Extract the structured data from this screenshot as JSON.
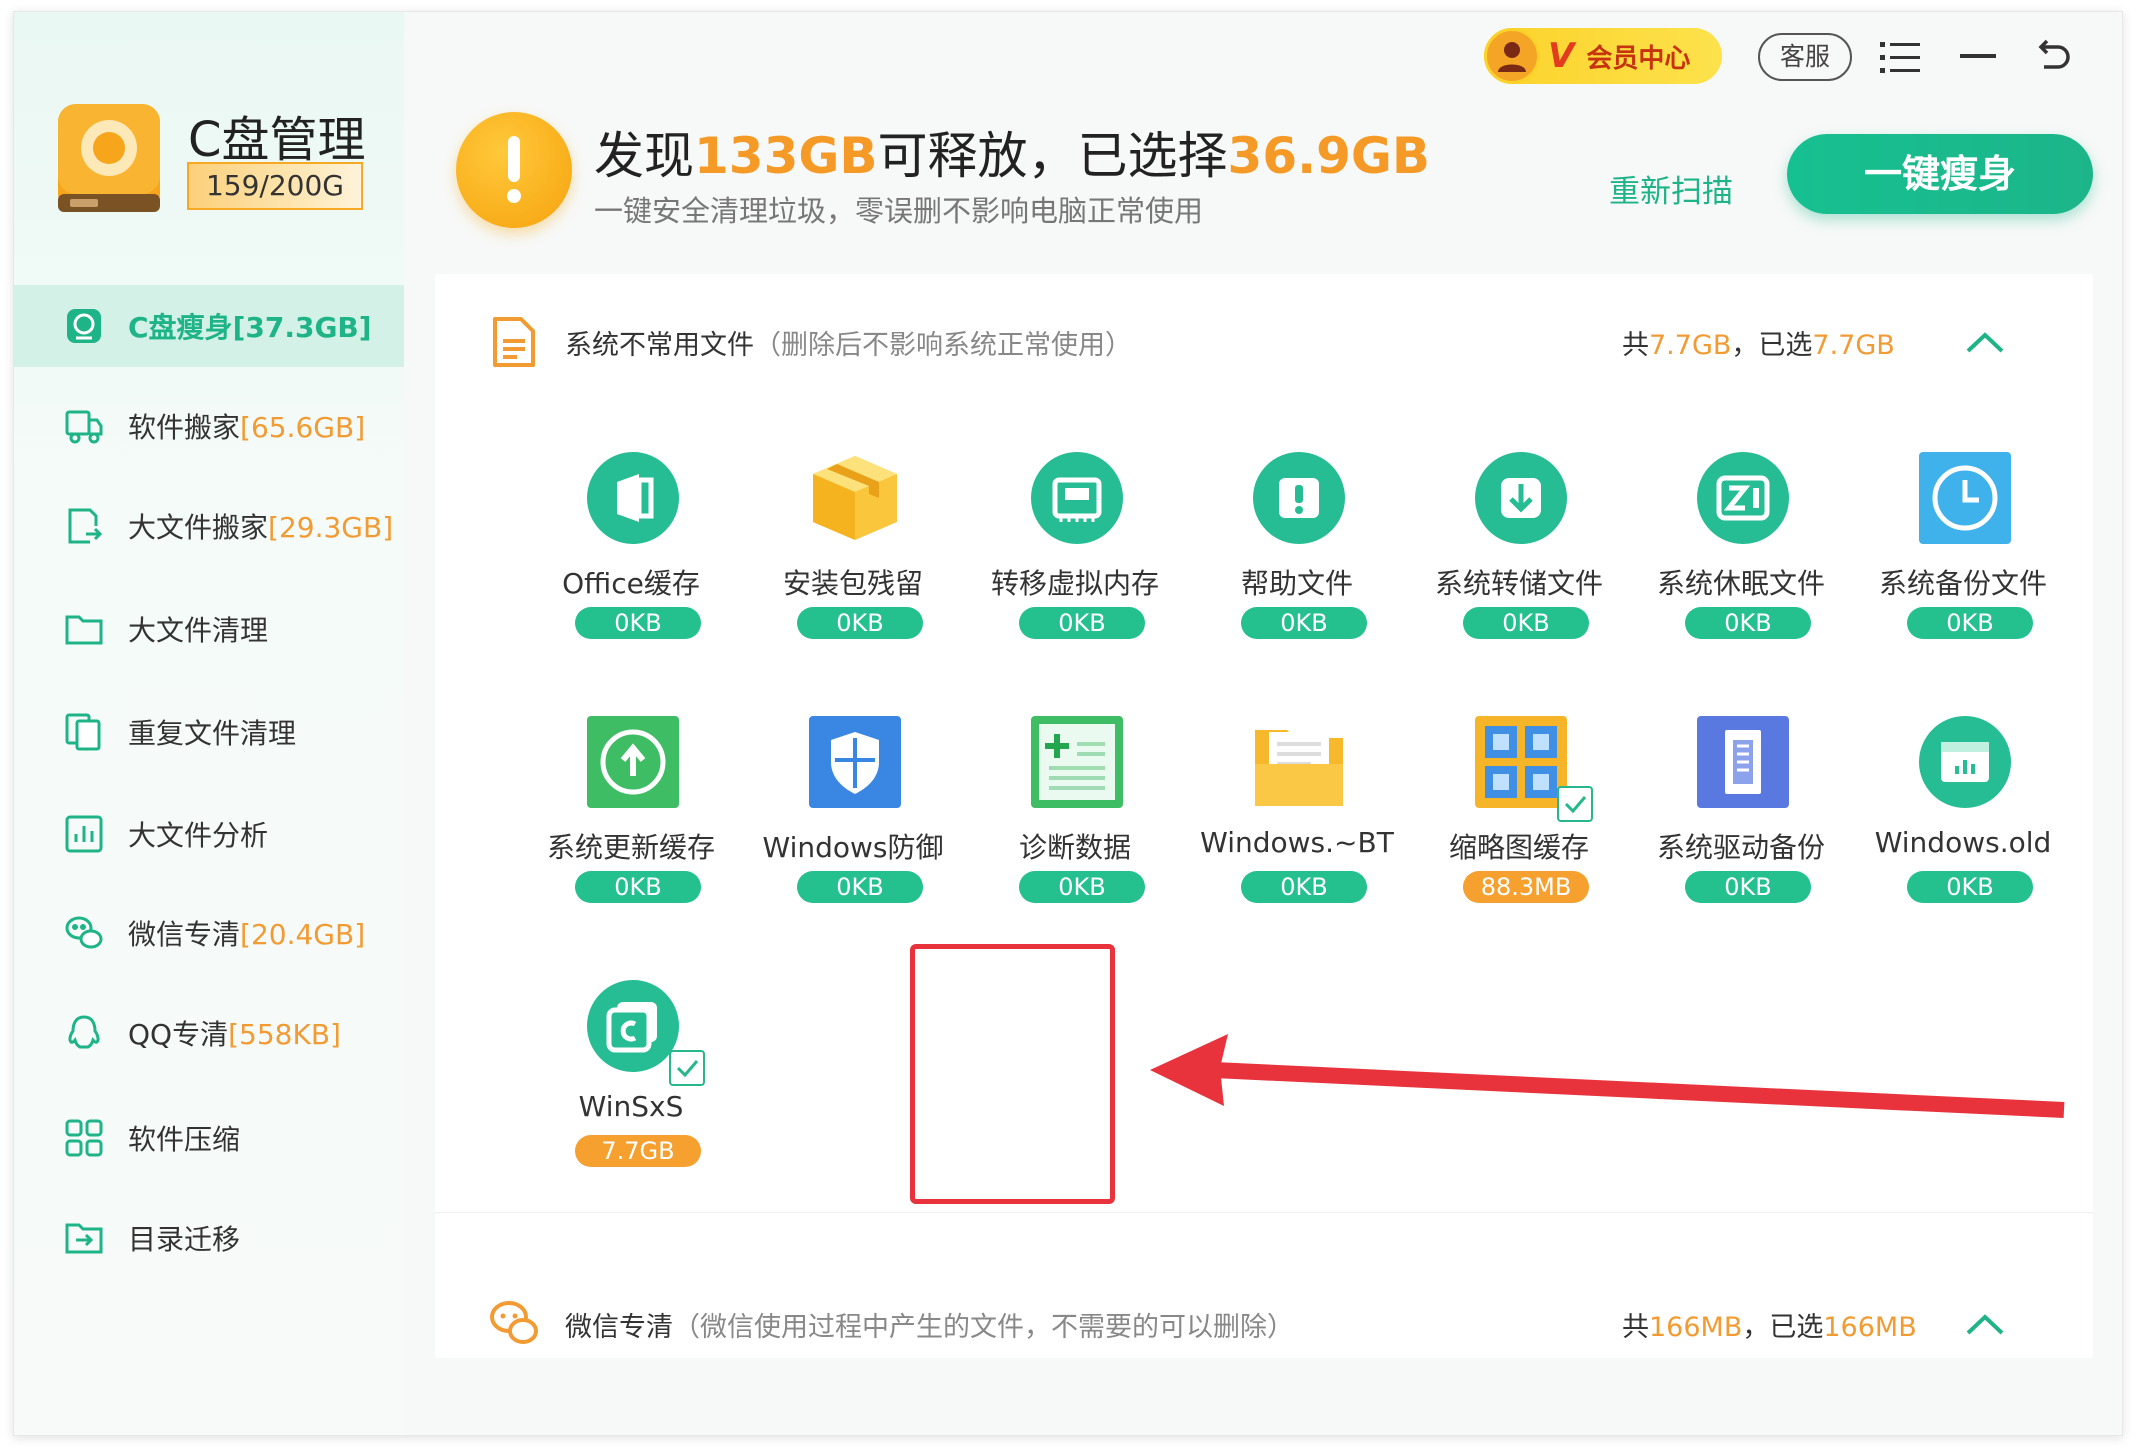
{
  "app": {
    "title": "C盘管理",
    "capacity": "159/200G"
  },
  "sidebar": {
    "items": [
      {
        "label": "C盘瘦身",
        "size": "[37.3GB]",
        "icon": "disk-slim-icon",
        "active": true
      },
      {
        "label": "软件搬家",
        "size": "[65.6GB]",
        "icon": "truck-icon",
        "active": false
      },
      {
        "label": "大文件搬家",
        "size": "[29.3GB]",
        "icon": "file-move-icon",
        "active": false
      },
      {
        "label": "大文件清理",
        "size": "",
        "icon": "folder-icon",
        "active": false
      },
      {
        "label": "重复文件清理",
        "size": "",
        "icon": "duplicate-icon",
        "active": false
      },
      {
        "label": "大文件分析",
        "size": "",
        "icon": "chart-icon",
        "active": false
      },
      {
        "label": "微信专清",
        "size": "[20.4GB]",
        "icon": "wechat-icon",
        "active": false
      },
      {
        "label": "QQ专清",
        "size": "[558KB]",
        "icon": "qq-icon",
        "active": false
      },
      {
        "label": "软件压缩",
        "size": "",
        "icon": "grid-icon",
        "active": false
      },
      {
        "label": "目录迁移",
        "size": "",
        "icon": "folder-export-icon",
        "active": false
      }
    ]
  },
  "topbar": {
    "vip_letter": "V",
    "vip_label": "会员中心",
    "service_label": "客服"
  },
  "summary": {
    "prefix": "发现",
    "found": "133GB",
    "middle": "可释放，已选择",
    "selected": "36.9GB",
    "subtitle": "一键安全清理垃圾，零误删不影响电脑正常使用",
    "rescan_label": "重新扫描",
    "action_label": "一键瘦身"
  },
  "section1": {
    "title": "系统不常用文件",
    "note": "（删除后不影响系统正常使用）",
    "total_prefix": "共",
    "total": "7.7GB",
    "sep": "，",
    "selected_prefix": "已选",
    "selected": "7.7GB",
    "items": [
      {
        "name": "Office缓存",
        "size": "0KB",
        "icon": "office-icon"
      },
      {
        "name": "安装包残留",
        "size": "0KB",
        "icon": "package-box-icon"
      },
      {
        "name": "转移虚拟内存",
        "size": "0KB",
        "icon": "memory-icon"
      },
      {
        "name": "帮助文件",
        "size": "0KB",
        "icon": "help-file-icon"
      },
      {
        "name": "系统转储文件",
        "size": "0KB",
        "icon": "download-icon"
      },
      {
        "name": "系统休眠文件",
        "size": "0KB",
        "icon": "sleep-icon"
      },
      {
        "name": "系统备份文件",
        "size": "0KB",
        "icon": "clock-backup-icon"
      },
      {
        "name": "系统更新缓存",
        "size": "0KB",
        "icon": "update-icon"
      },
      {
        "name": "Windows防御",
        "size": "0KB",
        "icon": "shield-icon"
      },
      {
        "name": "诊断数据",
        "size": "0KB",
        "icon": "diagnostics-icon"
      },
      {
        "name": "Windows.~BT",
        "size": "0KB",
        "icon": "folder-docs-icon"
      },
      {
        "name": "缩略图缓存",
        "size": "88.3MB",
        "icon": "thumbnail-icon"
      },
      {
        "name": "系统驱动备份",
        "size": "0KB",
        "icon": "driver-icon"
      },
      {
        "name": "Windows.old",
        "size": "0KB",
        "icon": "window-old-icon"
      },
      {
        "name": "WinSxS",
        "size": "7.7GB",
        "icon": "winsxs-icon"
      }
    ]
  },
  "section2": {
    "title": "微信专清",
    "note": "（微信使用过程中产生的文件，不需要的可以删除）",
    "total_prefix": "共",
    "total": "166MB",
    "sep": "，",
    "selected_prefix": "已选",
    "selected": "166MB"
  },
  "colors": {
    "accent": "#1fb487",
    "orange": "#f39b33",
    "highlight": "#e8333c"
  }
}
